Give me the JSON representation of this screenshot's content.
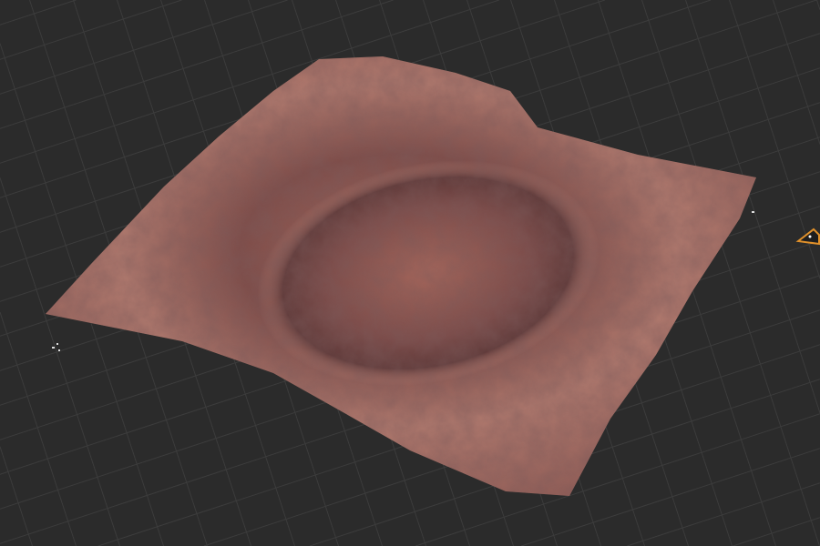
{
  "viewport": {
    "background_color": "#2b2b2b",
    "grid_color": "#3c3c3c",
    "terrain_base_color": "#9a6058",
    "terrain_highlight_color": "#c08478",
    "terrain_shadow_color": "#4e2e2e",
    "light_gizmo_color": "#e0902a"
  },
  "icons": [
    "light-gizmo-icon",
    "corner-marker-icon"
  ]
}
